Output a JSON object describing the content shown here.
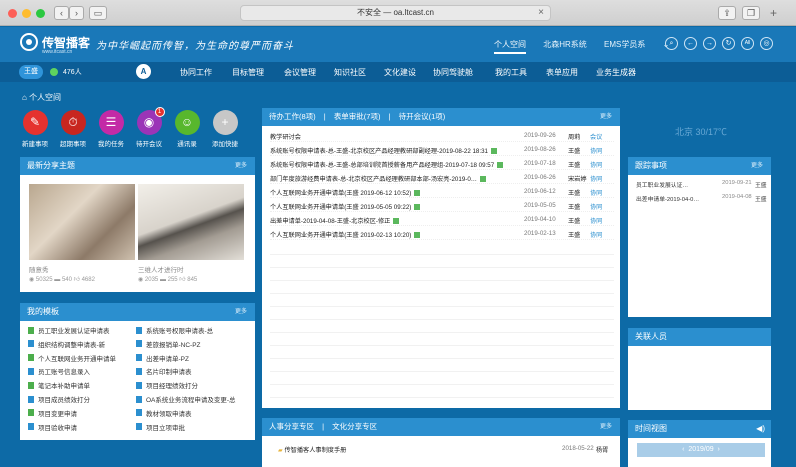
{
  "browser": {
    "url": "不安全 — oa.ltcast.cn"
  },
  "header": {
    "logo": "传智播客",
    "logo_sub": "www.itcast.cn",
    "slogan": "为中华崛起而传智，为生命的尊严而奋斗",
    "sys_nav": [
      "个人空间",
      "北森HR系统",
      "EMS学员系"
    ],
    "icon_all": "All"
  },
  "menu": {
    "user": "王盛",
    "online": "476人",
    "items": [
      "协同工作",
      "目标管理",
      "会议管理",
      "知识社区",
      "文化建设",
      "协同驾驶舱",
      "我的工具",
      "表单应用",
      "业务生成器"
    ]
  },
  "breadcrumb": "个人空间",
  "apps": [
    {
      "label": "新建事项",
      "color": "#e5322f",
      "icon": "✎"
    },
    {
      "label": "超期事项",
      "color": "#c8261f",
      "icon": "⏱"
    },
    {
      "label": "我的任务",
      "color": "#c32aa6",
      "icon": "☰"
    },
    {
      "label": "待开会议",
      "color": "#9b34b7",
      "icon": "◉",
      "badge": "1"
    },
    {
      "label": "通讯录",
      "color": "#58b72d",
      "icon": "☺"
    },
    {
      "label": "添加快捷",
      "color": "#c7c7c7",
      "icon": "+"
    }
  ],
  "topics": {
    "title": "最新分享主题",
    "more": "更多",
    "items": [
      {
        "caption": "随意秀",
        "views": "50325",
        "comments": "540",
        "likes": "4682"
      },
      {
        "caption": "三维人才进行时",
        "views": "2035",
        "comments": "255",
        "likes": "845"
      }
    ]
  },
  "templates": {
    "title": "我的模板",
    "more": "更多",
    "col1": [
      "员工职业发展认证申请表",
      "组织结构调整申请表-新",
      "个人互联网业务开通申请单",
      "员工账号信息录入",
      "笔记本补助申请单",
      "项目成员绩效打分",
      "项目变更申请",
      "项目验收申请"
    ],
    "col2": [
      "系统账号权限申请表-总",
      "差旅报销单-NC-PZ",
      "出差申请单-PZ",
      "名片印制申请表",
      "项目经理绩效打分",
      "OA系统业务流程申请及变更-总",
      "教材领取申请表",
      "项目立项审批"
    ]
  },
  "pending": {
    "tab1": "待办工作(8项)",
    "tab2": "表单审批(7项)",
    "tab3": "待开会议(1项)",
    "more": "更多",
    "rows": [
      {
        "title": "教学研讨会",
        "date": "2019-09-26",
        "person": "周莉",
        "type": "会议"
      },
      {
        "title": "系统账号权限申请表-总-王盛-北京校区产品经理教研部副经理-2019-08-22 18:31",
        "date": "2019-08-26",
        "person": "王盛",
        "type": "协同"
      },
      {
        "title": "系统账号权限申请表-总-王盛-总部培训院首授薪备用产品经理组-2019-07-18 09:57",
        "date": "2019-07-18",
        "person": "王盛",
        "type": "协同"
      },
      {
        "title": "部门年度旅游经费申请表-总-北京校区产品经理教研部本部-汤宏亮-2019-0…",
        "date": "2019-06-26",
        "person": "宋岩婷",
        "type": "协同"
      },
      {
        "title": "个人互联网业务开通申请单(王盛 2019-06-12 10:52)",
        "date": "2019-06-12",
        "person": "王盛",
        "type": "协同"
      },
      {
        "title": "个人互联网业务开通申请单(王盛 2019-05-05 09:22)",
        "date": "2019-05-05",
        "person": "王盛",
        "type": "协同"
      },
      {
        "title": "出差申请单-2019-04-08-王盛-北京校区-修正",
        "date": "2019-04-10",
        "person": "王盛",
        "type": "协同"
      },
      {
        "title": "个人互联网业务开通申请单(王盛 2019-02-13 10:20)",
        "date": "2019-02-13",
        "person": "王盛",
        "type": "协同"
      }
    ]
  },
  "weather": "北京 30/17℃",
  "tracking": {
    "title": "跟踪事项",
    "more": "更多",
    "rows": [
      {
        "title": "员工职业发展认证…",
        "date": "2019-09-21",
        "person": "王盛"
      },
      {
        "title": "出差申请单-2019-04-0…",
        "date": "2019-04-08",
        "person": "王盛"
      }
    ]
  },
  "contacts": {
    "title": "关联人员"
  },
  "share": {
    "tab1": "人事分享专区",
    "tab2": "文化分享专区",
    "more": "更多",
    "row": {
      "title": "传智播客人事制度手册",
      "date": "2018-05-22",
      "person": "杨胥"
    }
  },
  "timeview": {
    "title": "时间视图",
    "month": "2019/09"
  }
}
